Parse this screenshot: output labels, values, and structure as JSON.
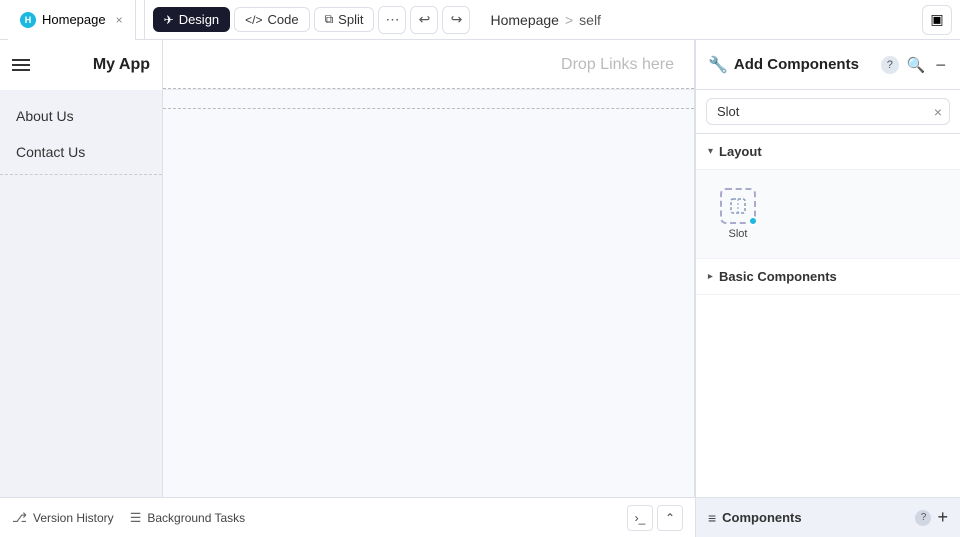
{
  "topbar": {
    "tab_label": "Homepage",
    "tab_close": "×",
    "design_label": "Design",
    "code_label": "Code",
    "split_label": "Split",
    "undo_icon": "↩",
    "redo_icon": "↪",
    "breadcrumb_home": "Homepage",
    "breadcrumb_sep": ">",
    "breadcrumb_current": "self",
    "panel_toggle_icon": "▣"
  },
  "nav_sidebar": {
    "app_title": "My App",
    "drop_links": "Drop Links here",
    "nav_items": [
      {
        "label": "About Us"
      },
      {
        "label": "Contact Us"
      }
    ]
  },
  "right_panel": {
    "title": "Add Components",
    "search_placeholder": "Slot",
    "search_value": "Slot",
    "sections": [
      {
        "label": "Layout",
        "expanded": true,
        "components": [
          {
            "label": "Slot"
          }
        ]
      },
      {
        "label": "Basic Components",
        "expanded": false,
        "components": []
      }
    ],
    "bottom_title": "Components"
  },
  "statusbar": {
    "version_history_label": "Version History",
    "background_tasks_label": "Background Tasks"
  },
  "icons": {
    "wrench": "🔧",
    "search": "🔍",
    "close": "×",
    "chevron_down": "▾",
    "chevron_right": "▸",
    "slot_unicode": "⊡",
    "components_icon": "≡",
    "version_icon": "⎇",
    "tasks_icon": "☰",
    "terminal_icon": "›_",
    "collapse_icon": "⌃"
  }
}
